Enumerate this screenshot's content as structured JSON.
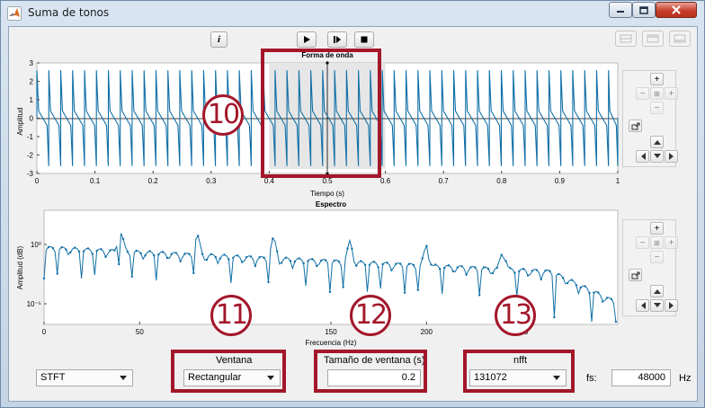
{
  "window": {
    "title": "Suma de tonos"
  },
  "toolbar": {
    "info_label": "i"
  },
  "waveform": {
    "title": "Forma de onda",
    "xlabel": "Tiempo (s)",
    "ylabel": "Amplitud",
    "xticks": [
      "0",
      "0.1",
      "0.2",
      "0.3",
      "0.4",
      "0.5",
      "0.6",
      "0.7",
      "0.8",
      "0.9",
      "1"
    ],
    "yticks": [
      "3",
      "2",
      "1",
      "0",
      "-1",
      "-2",
      "-3"
    ]
  },
  "spectrum": {
    "title": "Espectro",
    "xlabel": "Frecuencia (Hz)",
    "ylabel": "Amplitud (dB)",
    "xticks": [
      "0",
      "50",
      "100",
      "150",
      "200",
      "250"
    ],
    "yticks": [
      "10⁰",
      "10⁻⁵"
    ]
  },
  "controls": {
    "method_value": "STFT",
    "window_label": "Ventana",
    "window_value": "Rectangular",
    "window_size_label": "Tamaño de ventana (s)",
    "window_size_value": "0.2",
    "nfft_label": "nfft",
    "nfft_value": "131072",
    "fs_label": "fs:",
    "fs_value": "48000",
    "fs_unit": "Hz"
  },
  "annotations": {
    "a10": "10",
    "a11": "11",
    "a12": "12",
    "a13": "13"
  },
  "colors": {
    "signal": "#0f6fa6",
    "highlight": "#a3172a",
    "selection": "#e6e6e6"
  },
  "chart_data": [
    {
      "type": "line",
      "title": "Forma de onda",
      "xlabel": "Tiempo (s)",
      "ylabel": "Amplitud",
      "xlim": [
        0,
        1
      ],
      "ylim": [
        -3,
        3
      ],
      "selection": [
        0.4,
        0.6
      ],
      "series": [
        {
          "x": [
            0,
            1
          ],
          "period": 0.0205,
          "peak": 2.6
        }
      ]
    },
    {
      "type": "line",
      "title": "Espectro",
      "xlabel": "Frecuencia (Hz)",
      "ylabel": "Amplitud (dB)",
      "xlim": [
        0,
        300
      ],
      "y_scale": "log",
      "series": [
        {
          "lobe_peaks_hz": [
            40,
            80,
            120,
            160,
            200,
            240
          ]
        }
      ]
    }
  ]
}
